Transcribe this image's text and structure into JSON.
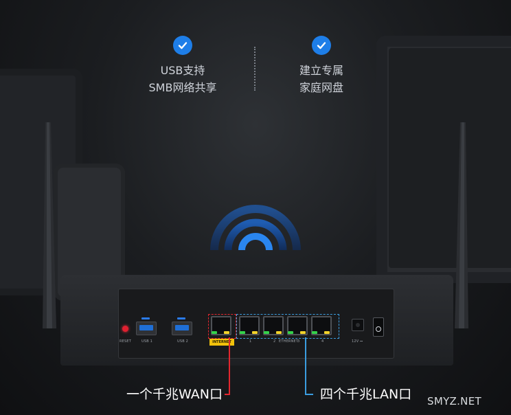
{
  "features": [
    {
      "icon": "check-icon",
      "line1": "USB支持",
      "line2": "SMB网络共享"
    },
    {
      "icon": "check-icon",
      "line1": "建立专属",
      "line2": "家庭网盘"
    }
  ],
  "router_panel": {
    "reset_label": "RESET",
    "usb_ports": [
      "USB 1",
      "USB 2"
    ],
    "internet_label": "INTERNET",
    "lan_numbers": [
      "1",
      "2",
      "3",
      "4"
    ],
    "ethernet_label": "ETHERNET",
    "power_label": "12V ⎓"
  },
  "callouts": {
    "wan": "一个千兆WAN口",
    "lan": "四个千兆LAN口"
  },
  "watermark": "SMYZ.NET",
  "colors": {
    "accent_blue": "#1e7ee8",
    "wan_highlight": "#e3262e",
    "lan_highlight": "#3b9de0",
    "internet_tag": "#f2c20c"
  }
}
